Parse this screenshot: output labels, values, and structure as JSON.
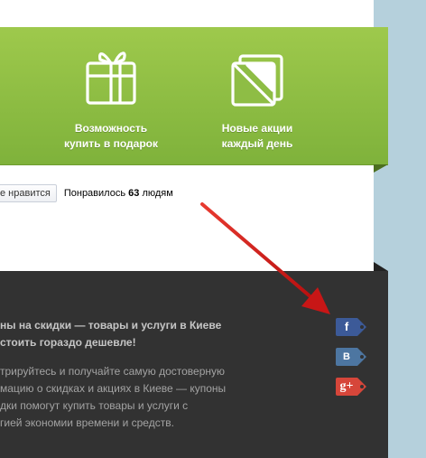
{
  "features": [
    {
      "icon": "gift-icon",
      "line1": "Возможность",
      "line2": "купить в подарок"
    },
    {
      "icon": "new-deals-icon",
      "line1": "Новые акции",
      "line2": "каждый день"
    }
  ],
  "like": {
    "button_label": "е нравится",
    "text_prefix": "Понравилось",
    "count": "63",
    "text_suffix": "людям"
  },
  "footer": {
    "title_lines": [
      "ны на скидки — товары и услуги в Киеве",
      "стоить гораздо дешевле!"
    ],
    "desc_lines": [
      "трируйтесь и получайте самую достоверную",
      "мацию о скидках и акциях в Киеве — купоны",
      "дки помогут купить товары и услуги с",
      "гией экономии времени и средств."
    ]
  },
  "social": [
    {
      "icon": "facebook-icon",
      "glyph": "f",
      "color": "#3c5a98"
    },
    {
      "icon": "vkontakte-icon",
      "glyph": "B",
      "color": "#4d76a1"
    },
    {
      "icon": "google-plus-icon",
      "glyph": "g+",
      "color": "#d6463a"
    }
  ],
  "colors": {
    "banner_green": "#8fbf45",
    "footer_dark": "#323232",
    "arrow_red": "#d31a1a"
  }
}
